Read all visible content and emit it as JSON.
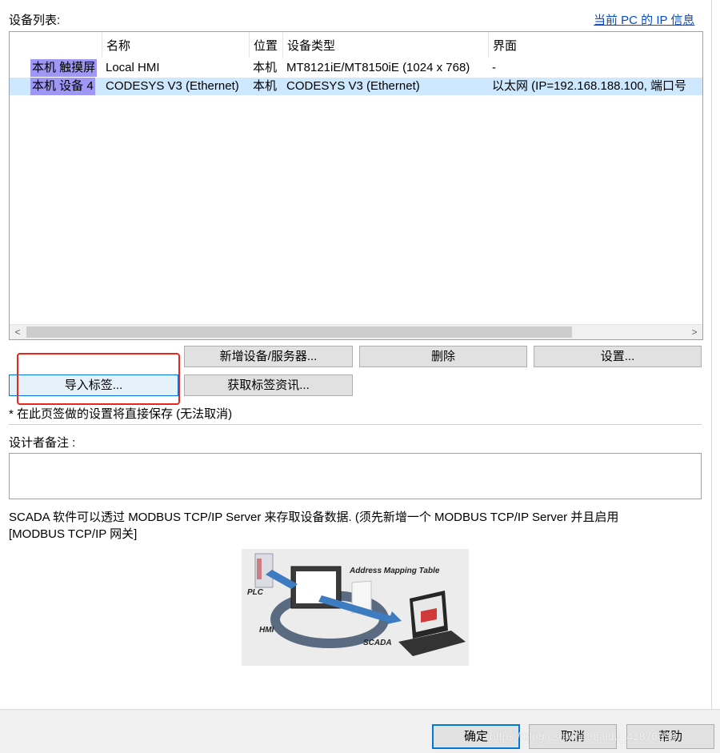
{
  "device_list_label": "设备列表:",
  "pc_ip_link": "当前 PC 的 IP 信息",
  "table": {
    "headers": [
      "",
      "名称",
      "位置",
      "设备类型",
      "界面"
    ],
    "rows": [
      {
        "id": "本机 触摸屏",
        "name": "Local HMI",
        "location": "本机",
        "type": "MT8121iE/MT8150iE (1024 x 768)",
        "interface": "-",
        "selected": false
      },
      {
        "id": "本机 设备 4",
        "name": "CODESYS V3 (Ethernet)",
        "location": "本机",
        "type": "CODESYS V3 (Ethernet)",
        "interface": "以太网 (IP=192.168.188.100, 端口号",
        "selected": true
      }
    ],
    "scroll_left": "<",
    "scroll_right": ">"
  },
  "buttons": {
    "add_device": "新增设备/服务器...",
    "delete": "删除",
    "settings": "设置...",
    "import_tags": "导入标签...",
    "get_tag_info": "获取标签资讯..."
  },
  "note_autosave": "* 在此页签做的设置将直接保存 (无法取消)",
  "designer_notes_label": "设计者备注 :",
  "designer_notes_value": "",
  "scada_text_line1": "SCADA 软件可以透过 MODBUS TCP/IP Server 来存取设备数据. (须先新增一个 MODBUS TCP/IP Server 并且启用",
  "scada_text_line2": "[MODBUS TCP/IP 网关]",
  "diagram": {
    "address_mapping": "Address Mapping Table",
    "plc": "PLC",
    "hmi": "HMI",
    "scada": "SCADA"
  },
  "footer": {
    "ok": "确定",
    "cancel": "取消",
    "help": "帮助",
    "watermark": "https://blog.csdn.net/baidu_41876898"
  },
  "colors": {
    "accent": "#0078d7",
    "selected_row": "#cde8ff",
    "id_highlight": "#9e97f5",
    "highlight_box": "#e8261c",
    "link": "#0a4cc9"
  }
}
